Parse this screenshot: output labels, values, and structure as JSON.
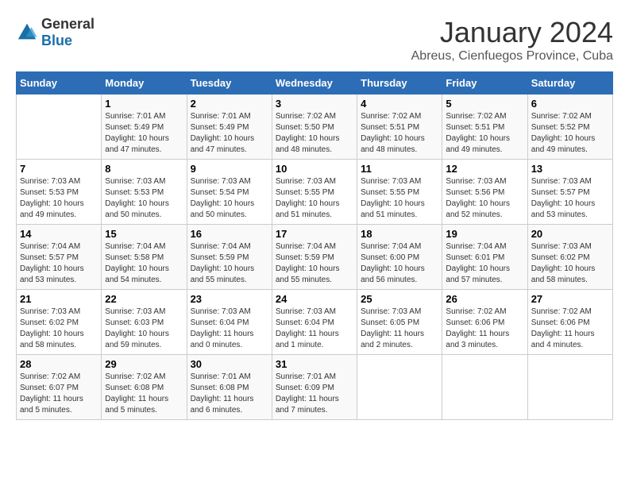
{
  "header": {
    "logo_general": "General",
    "logo_blue": "Blue",
    "month": "January 2024",
    "location": "Abreus, Cienfuegos Province, Cuba"
  },
  "days_of_week": [
    "Sunday",
    "Monday",
    "Tuesday",
    "Wednesday",
    "Thursday",
    "Friday",
    "Saturday"
  ],
  "weeks": [
    [
      {
        "day": "",
        "sunrise": "",
        "sunset": "",
        "daylight": ""
      },
      {
        "day": "1",
        "sunrise": "7:01 AM",
        "sunset": "5:49 PM",
        "daylight": "10 hours and 47 minutes."
      },
      {
        "day": "2",
        "sunrise": "7:01 AM",
        "sunset": "5:49 PM",
        "daylight": "10 hours and 47 minutes."
      },
      {
        "day": "3",
        "sunrise": "7:02 AM",
        "sunset": "5:50 PM",
        "daylight": "10 hours and 48 minutes."
      },
      {
        "day": "4",
        "sunrise": "7:02 AM",
        "sunset": "5:51 PM",
        "daylight": "10 hours and 48 minutes."
      },
      {
        "day": "5",
        "sunrise": "7:02 AM",
        "sunset": "5:51 PM",
        "daylight": "10 hours and 49 minutes."
      },
      {
        "day": "6",
        "sunrise": "7:02 AM",
        "sunset": "5:52 PM",
        "daylight": "10 hours and 49 minutes."
      }
    ],
    [
      {
        "day": "7",
        "sunrise": "7:03 AM",
        "sunset": "5:53 PM",
        "daylight": "10 hours and 49 minutes."
      },
      {
        "day": "8",
        "sunrise": "7:03 AM",
        "sunset": "5:53 PM",
        "daylight": "10 hours and 50 minutes."
      },
      {
        "day": "9",
        "sunrise": "7:03 AM",
        "sunset": "5:54 PM",
        "daylight": "10 hours and 50 minutes."
      },
      {
        "day": "10",
        "sunrise": "7:03 AM",
        "sunset": "5:55 PM",
        "daylight": "10 hours and 51 minutes."
      },
      {
        "day": "11",
        "sunrise": "7:03 AM",
        "sunset": "5:55 PM",
        "daylight": "10 hours and 51 minutes."
      },
      {
        "day": "12",
        "sunrise": "7:03 AM",
        "sunset": "5:56 PM",
        "daylight": "10 hours and 52 minutes."
      },
      {
        "day": "13",
        "sunrise": "7:03 AM",
        "sunset": "5:57 PM",
        "daylight": "10 hours and 53 minutes."
      }
    ],
    [
      {
        "day": "14",
        "sunrise": "7:04 AM",
        "sunset": "5:57 PM",
        "daylight": "10 hours and 53 minutes."
      },
      {
        "day": "15",
        "sunrise": "7:04 AM",
        "sunset": "5:58 PM",
        "daylight": "10 hours and 54 minutes."
      },
      {
        "day": "16",
        "sunrise": "7:04 AM",
        "sunset": "5:59 PM",
        "daylight": "10 hours and 55 minutes."
      },
      {
        "day": "17",
        "sunrise": "7:04 AM",
        "sunset": "5:59 PM",
        "daylight": "10 hours and 55 minutes."
      },
      {
        "day": "18",
        "sunrise": "7:04 AM",
        "sunset": "6:00 PM",
        "daylight": "10 hours and 56 minutes."
      },
      {
        "day": "19",
        "sunrise": "7:04 AM",
        "sunset": "6:01 PM",
        "daylight": "10 hours and 57 minutes."
      },
      {
        "day": "20",
        "sunrise": "7:03 AM",
        "sunset": "6:02 PM",
        "daylight": "10 hours and 58 minutes."
      }
    ],
    [
      {
        "day": "21",
        "sunrise": "7:03 AM",
        "sunset": "6:02 PM",
        "daylight": "10 hours and 58 minutes."
      },
      {
        "day": "22",
        "sunrise": "7:03 AM",
        "sunset": "6:03 PM",
        "daylight": "10 hours and 59 minutes."
      },
      {
        "day": "23",
        "sunrise": "7:03 AM",
        "sunset": "6:04 PM",
        "daylight": "11 hours and 0 minutes."
      },
      {
        "day": "24",
        "sunrise": "7:03 AM",
        "sunset": "6:04 PM",
        "daylight": "11 hours and 1 minute."
      },
      {
        "day": "25",
        "sunrise": "7:03 AM",
        "sunset": "6:05 PM",
        "daylight": "11 hours and 2 minutes."
      },
      {
        "day": "26",
        "sunrise": "7:02 AM",
        "sunset": "6:06 PM",
        "daylight": "11 hours and 3 minutes."
      },
      {
        "day": "27",
        "sunrise": "7:02 AM",
        "sunset": "6:06 PM",
        "daylight": "11 hours and 4 minutes."
      }
    ],
    [
      {
        "day": "28",
        "sunrise": "7:02 AM",
        "sunset": "6:07 PM",
        "daylight": "11 hours and 5 minutes."
      },
      {
        "day": "29",
        "sunrise": "7:02 AM",
        "sunset": "6:08 PM",
        "daylight": "11 hours and 5 minutes."
      },
      {
        "day": "30",
        "sunrise": "7:01 AM",
        "sunset": "6:08 PM",
        "daylight": "11 hours and 6 minutes."
      },
      {
        "day": "31",
        "sunrise": "7:01 AM",
        "sunset": "6:09 PM",
        "daylight": "11 hours and 7 minutes."
      },
      {
        "day": "",
        "sunrise": "",
        "sunset": "",
        "daylight": ""
      },
      {
        "day": "",
        "sunrise": "",
        "sunset": "",
        "daylight": ""
      },
      {
        "day": "",
        "sunrise": "",
        "sunset": "",
        "daylight": ""
      }
    ]
  ],
  "labels": {
    "sunrise_prefix": "Sunrise: ",
    "sunset_prefix": "Sunset: ",
    "daylight_prefix": "Daylight: "
  }
}
